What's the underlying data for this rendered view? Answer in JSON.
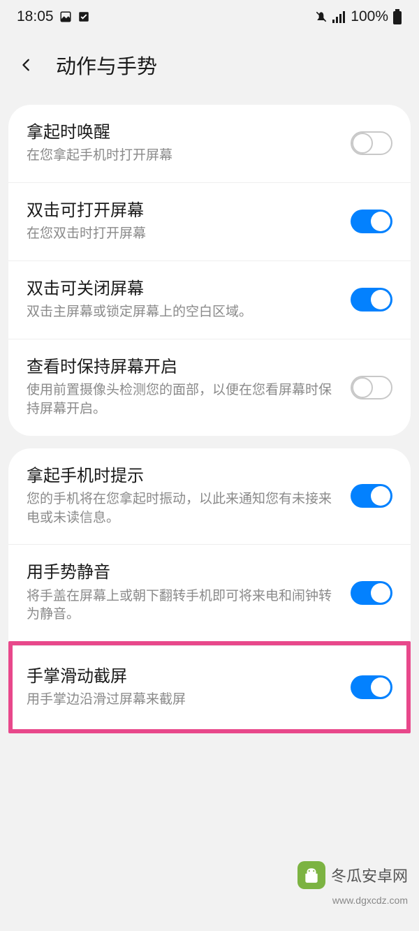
{
  "status": {
    "time": "18:05",
    "battery_pct": "100%"
  },
  "header": {
    "title": "动作与手势"
  },
  "group1": {
    "items": [
      {
        "title": "拿起时唤醒",
        "desc": "在您拿起手机时打开屏幕",
        "on": false
      },
      {
        "title": "双击可打开屏幕",
        "desc": "在您双击时打开屏幕",
        "on": true
      },
      {
        "title": "双击可关闭屏幕",
        "desc": "双击主屏幕或锁定屏幕上的空白区域。",
        "on": true
      },
      {
        "title": "查看时保持屏幕开启",
        "desc": "使用前置摄像头检测您的面部，以便在您看屏幕时保持屏幕开启。",
        "on": false
      }
    ]
  },
  "group2": {
    "items": [
      {
        "title": "拿起手机时提示",
        "desc": "您的手机将在您拿起时振动，以此来通知您有未接来电或未读信息。",
        "on": true
      },
      {
        "title": "用手势静音",
        "desc": "将手盖在屏幕上或朝下翻转手机即可将来电和闹钟转为静音。",
        "on": true
      }
    ]
  },
  "highlighted": {
    "title": "手掌滑动截屏",
    "desc": "用手掌边沿滑过屏幕来截屏",
    "on": true
  },
  "watermark": {
    "brand": "冬瓜安卓网",
    "url": "www.dgxcdz.com"
  }
}
